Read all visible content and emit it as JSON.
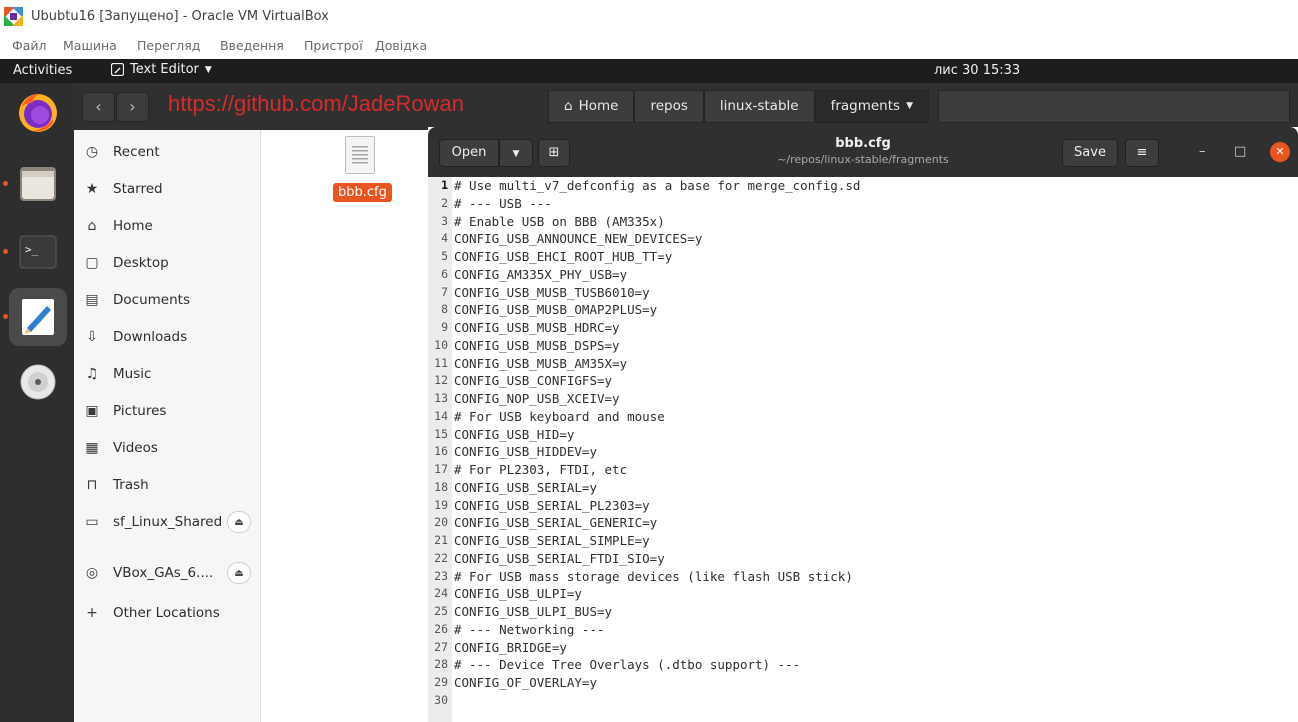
{
  "vbox": {
    "title": "Ububtu16 [Запущено] - Oracle VM VirtualBox",
    "menu": [
      "Файл",
      "Машина",
      "Перегляд",
      "Введення",
      "Пристрої",
      "Довідка"
    ]
  },
  "gnome": {
    "activities": "Activities",
    "app_menu": "Text Editor",
    "clock": "лис 30  15:33"
  },
  "dock": {
    "apps": [
      "firefox-icon",
      "files-icon",
      "terminal-icon",
      "text-editor-icon",
      "dvd-icon"
    ]
  },
  "files": {
    "watermark": "https://github.com/JadeRowan",
    "breadcrumbs": [
      "Home",
      "repos",
      "linux-stable",
      "fragments"
    ],
    "sidebar": [
      {
        "icon": "clock-icon",
        "label": "Recent"
      },
      {
        "icon": "star-icon",
        "label": "Starred"
      },
      {
        "icon": "home-icon",
        "label": "Home"
      },
      {
        "icon": "desktop-icon",
        "label": "Desktop"
      },
      {
        "icon": "documents-icon",
        "label": "Documents"
      },
      {
        "icon": "downloads-icon",
        "label": "Downloads"
      },
      {
        "icon": "music-icon",
        "label": "Music"
      },
      {
        "icon": "pictures-icon",
        "label": "Pictures"
      },
      {
        "icon": "videos-icon",
        "label": "Videos"
      },
      {
        "icon": "trash-icon",
        "label": "Trash"
      },
      {
        "icon": "drive-icon",
        "label": "sf_Linux_Shared"
      },
      {
        "icon": "disc-icon",
        "label": "VBox_GAs_6...."
      },
      {
        "icon": "plus-icon",
        "label": "Other Locations"
      }
    ],
    "file_name": "bbb.cfg"
  },
  "editor": {
    "open_label": "Open",
    "save_label": "Save",
    "doc_title": "bbb.cfg",
    "doc_path": "~/repos/linux-stable/fragments",
    "current_line": 1,
    "lines": [
      "# Use multi_v7_defconfig as a base for merge_config.sd",
      "# --- USB ---",
      "# Enable USB on BBB (AM335x)",
      "CONFIG_USB_ANNOUNCE_NEW_DEVICES=y",
      "CONFIG_USB_EHCI_ROOT_HUB_TT=y",
      "CONFIG_AM335X_PHY_USB=y",
      "CONFIG_USB_MUSB_TUSB6010=y",
      "CONFIG_USB_MUSB_OMAP2PLUS=y",
      "CONFIG_USB_MUSB_HDRC=y",
      "CONFIG_USB_MUSB_DSPS=y",
      "CONFIG_USB_MUSB_AM35X=y",
      "CONFIG_USB_CONFIGFS=y",
      "CONFIG_NOP_USB_XCEIV=y",
      "# For USB keyboard and mouse",
      "CONFIG_USB_HID=y",
      "CONFIG_USB_HIDDEV=y",
      "# For PL2303, FTDI, etc",
      "CONFIG_USB_SERIAL=y",
      "CONFIG_USB_SERIAL_PL2303=y",
      "CONFIG_USB_SERIAL_GENERIC=y",
      "CONFIG_USB_SERIAL_SIMPLE=y",
      "CONFIG_USB_SERIAL_FTDI_SIO=y",
      "# For USB mass storage devices (like flash USB stick)",
      "CONFIG_USB_ULPI=y",
      "CONFIG_USB_ULPI_BUS=y",
      "# --- Networking ---",
      "CONFIG_BRIDGE=y",
      "# --- Device Tree Overlays (.dtbo support) ---",
      "CONFIG_OF_OVERLAY=y",
      ""
    ]
  },
  "colors": {
    "accent": "#e95420",
    "watermark": "#d62b2b",
    "topbar": "#1d1d1d",
    "dock": "#2e2e2e",
    "headerbar": "#303030"
  }
}
